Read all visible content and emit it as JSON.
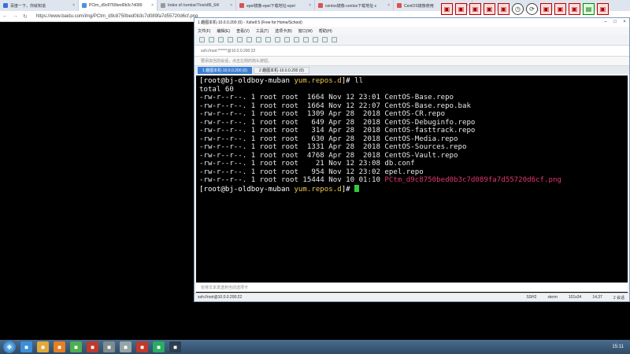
{
  "browser": {
    "tabs": [
      {
        "label": "百度一下，你就知道",
        "color": "#3b6fd8"
      },
      {
        "label": "PCtm_d9c8750bed0b3c7d089",
        "color": "#4a90e2"
      },
      {
        "label": "Index of /centos/7/os/x86_64/",
        "color": "#999999"
      },
      {
        "label": "epel镜像-epel下载地址-epel",
        "color": "#d9534f"
      },
      {
        "label": "centos镜像-centos下载地址-c",
        "color": "#d9534f"
      },
      {
        "label": "CentOS镜像使用",
        "color": "#d9534f"
      }
    ],
    "url": "https://www.baidu.com/img/PCtm_d9c8750bed0b3c7d089fa7d55720d6cf.png"
  },
  "xshell": {
    "title": "1 趣图本机-10.0.0.200 (0) - Xshell 5 (Free for Home/School)",
    "menu": [
      "文件(F)",
      "编辑(E)",
      "查看(V)",
      "工具(T)",
      "选项卡(B)",
      "窗口(W)",
      "帮助(H)"
    ],
    "address": "ssh://root:******@10.0.0.200:22",
    "hint": "要添加当前会话，点击左侧的箭头按钮。",
    "session_tabs": [
      {
        "label": "1 趣图本机-10.0.0.200 (0)",
        "active": true
      },
      {
        "label": "2 趣图本机-10.0.0.200 (0)",
        "active": false
      }
    ],
    "send_placeholder": "仅将文本发送到当前选项卡",
    "status_left": "ssh://root@10.0.0.200:22",
    "status_right": [
      "SSH2",
      "xterm",
      "101x34",
      "14,37",
      "2 会话"
    ]
  },
  "terminal": {
    "prompt_user": "[root@bj-oldboy-muban ",
    "prompt_dir": "yum.repos.d",
    "prompt_end": "]# ",
    "command": "ll",
    "total": "total 60",
    "rows": [
      {
        "text": "-rw-r--r--. 1 root root  1664 Nov 12 23:01 CentOS-Base.repo",
        "highlight": false
      },
      {
        "text": "-rw-r--r--. 1 root root  1664 Nov 12 22:07 CentOS-Base.repo.bak",
        "highlight": false
      },
      {
        "text": "-rw-r--r--. 1 root root  1309 Apr 28  2018 CentOS-CR.repo",
        "highlight": false
      },
      {
        "text": "-rw-r--r--. 1 root root   649 Apr 28  2018 CentOS-Debuginfo.repo",
        "highlight": false
      },
      {
        "text": "-rw-r--r--. 1 root root   314 Apr 28  2018 CentOS-fasttrack.repo",
        "highlight": false
      },
      {
        "text": "-rw-r--r--. 1 root root   630 Apr 28  2018 CentOS-Media.repo",
        "highlight": false
      },
      {
        "text": "-rw-r--r--. 1 root root  1331 Apr 28  2018 CentOS-Sources.repo",
        "highlight": false
      },
      {
        "text": "-rw-r--r--. 1 root root  4768 Apr 28  2018 CentOS-Vault.repo",
        "highlight": false
      },
      {
        "text": "-rw-r--r--. 1 root root    21 Nov 12 23:08 db.conf",
        "highlight": false
      },
      {
        "text": "-rw-r--r--. 1 root root   954 Nov 12 23:02 epel.repo",
        "highlight": false
      }
    ],
    "last_row_prefix": "-rw-r--r--. 1 root root 15444 Nov 10 01:10 ",
    "last_row_file": "PCtm_d9c8750bed0b3c7d089fa7d55720d6cf.png"
  },
  "taskbar": {
    "icons": [
      {
        "name": "ie-icon",
        "color": "#3b8fd8"
      },
      {
        "name": "folder-icon",
        "color": "#e0a93b"
      },
      {
        "name": "media-player-icon",
        "color": "#e67e22"
      },
      {
        "name": "chrome-icon",
        "color": "#4caf50"
      },
      {
        "name": "xshell-icon",
        "color": "#c0392b"
      },
      {
        "name": "notepad-icon",
        "color": "#7f8c8d"
      },
      {
        "name": "vmware-icon",
        "color": "#95a5a6"
      },
      {
        "name": "wps-icon",
        "color": "#c0392b"
      },
      {
        "name": "screen-recorder-icon",
        "color": "#27ae60"
      },
      {
        "name": "terminal-icon",
        "color": "#2c3e50"
      }
    ],
    "clock": "15:11"
  }
}
